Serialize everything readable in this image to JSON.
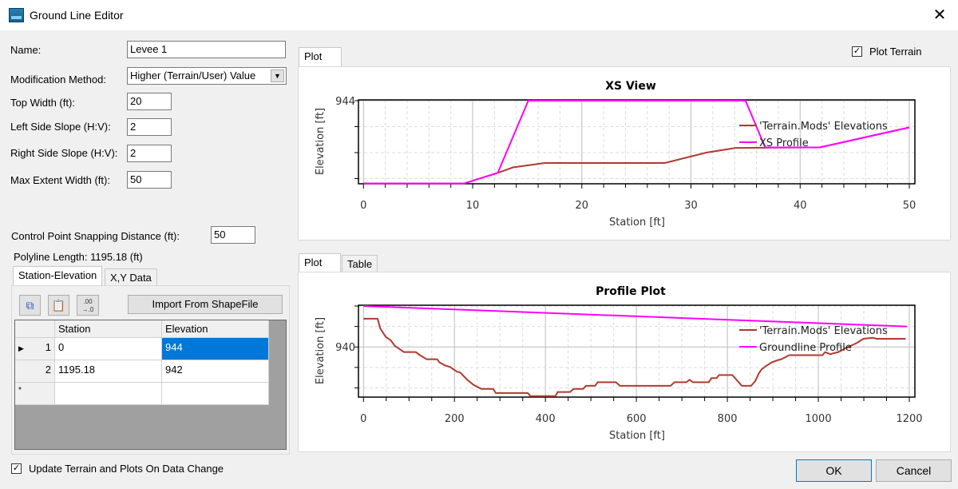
{
  "window": {
    "title": "Ground Line Editor",
    "close_icon": "close-icon"
  },
  "form": {
    "name_label": "Name:",
    "name_value": "Levee 1",
    "method_label": "Modification Method:",
    "method_value": "Higher (Terrain/User) Value",
    "top_width_label": "Top Width (ft):",
    "top_width_value": "20",
    "left_slope_label": "Left Side Slope (H:V):",
    "left_slope_value": "2",
    "right_slope_label": "Right Side Slope (H:V):",
    "right_slope_value": "2",
    "max_extent_label": "Max Extent Width (ft):",
    "max_extent_value": "50",
    "snap_label": "Control Point Snapping Distance (ft):",
    "snap_value": "50",
    "polyline_length": "Polyline Length: 1195.18 (ft)"
  },
  "data_tabs": [
    {
      "label": "Station-Elevation",
      "active": true
    },
    {
      "label": "X,Y Data",
      "active": false
    }
  ],
  "toolbar": {
    "copy_icon": "copy-icon",
    "paste_icon": "paste-icon",
    "decimals_icon": "decimal-places-icon",
    "decimals_text": ".00\n→.0",
    "import_label": "Import From ShapeFile"
  },
  "table": {
    "columns": [
      "Station",
      "Elevation"
    ],
    "rows": [
      {
        "index": "1",
        "station": "0",
        "elevation": "944",
        "current": true
      },
      {
        "index": "2",
        "station": "1195.18",
        "elevation": "942"
      }
    ],
    "new_row_marker": "*"
  },
  "update_checkbox": {
    "label": "Update Terrain and Plots On Data Change",
    "checked": true
  },
  "plot_terrain": {
    "label": "Plot Terrain",
    "checked": true
  },
  "top_tabs": [
    {
      "label": "Plot",
      "active": true
    }
  ],
  "bottom_tabs": [
    {
      "label": "Plot",
      "active": true
    },
    {
      "label": "Table",
      "active": false
    }
  ],
  "buttons": {
    "ok": "OK",
    "cancel": "Cancel"
  },
  "colors": {
    "terrain": "#b03a2e",
    "profile": "#ff00ff",
    "selection": "#0078d7"
  },
  "chart_data": [
    {
      "type": "line",
      "title": "XS View",
      "xlabel": "Station [ft]",
      "ylabel": "Elevation [ft]",
      "xlim": [
        0,
        50
      ],
      "ylim": [
        940.8,
        944
      ],
      "x_ticks": [
        0,
        10,
        20,
        30,
        40,
        50
      ],
      "y_tick_labels": [
        944
      ],
      "grid": true,
      "legend": "top-right",
      "series": [
        {
          "name": "'Terrain.Mods' Elevations",
          "color": "#b03a2e",
          "points": [
            [
              0,
              940.81
            ],
            [
              9.2,
              940.81
            ],
            [
              12.3,
              941.22
            ],
            [
              13.7,
              941.43
            ],
            [
              16.6,
              941.6
            ],
            [
              27.6,
              941.6
            ],
            [
              31.4,
              942.0
            ],
            [
              34.1,
              942.18
            ],
            [
              41.8,
              942.2
            ],
            [
              50,
              942.97
            ]
          ]
        },
        {
          "name": "XS Profile",
          "color": "#ff00ff",
          "points": [
            [
              0,
              940.81
            ],
            [
              9.2,
              940.81
            ],
            [
              12.3,
              941.22
            ],
            [
              15.1,
              944
            ],
            [
              35.0,
              944
            ],
            [
              36.8,
              942.2
            ],
            [
              41.8,
              942.2
            ],
            [
              50,
              942.97
            ]
          ]
        }
      ]
    },
    {
      "type": "line",
      "title": "Profile Plot",
      "xlabel": "Station [ft]",
      "ylabel": "Elevation [ft]",
      "xlim": [
        0,
        1200
      ],
      "ylim": [
        935.1,
        944
      ],
      "x_ticks": [
        0,
        200,
        400,
        600,
        800,
        1000,
        1200
      ],
      "y_tick_labels": [
        940
      ],
      "grid": true,
      "legend": "top-right",
      "series": [
        {
          "name": "'Terrain.Mods' Elevations",
          "color": "#b03a2e",
          "points": [
            [
              0,
              942.76
            ],
            [
              31,
              942.76
            ],
            [
              37,
              941.8
            ],
            [
              49,
              940.98
            ],
            [
              60,
              940.65
            ],
            [
              69,
              940.1
            ],
            [
              89,
              939.5
            ],
            [
              115,
              939.5
            ],
            [
              124,
              939.2
            ],
            [
              139,
              938.8
            ],
            [
              162,
              938.8
            ],
            [
              167,
              938.5
            ],
            [
              179,
              938.2
            ],
            [
              190,
              938.05
            ],
            [
              205,
              937.6
            ],
            [
              213,
              937.5
            ],
            [
              228,
              936.8
            ],
            [
              242,
              936.3
            ],
            [
              259,
              935.9
            ],
            [
              285,
              935.9
            ],
            [
              291,
              935.5
            ],
            [
              361,
              935.5
            ],
            [
              367,
              935.2
            ],
            [
              422,
              935.2
            ],
            [
              427,
              935.6
            ],
            [
              454,
              935.6
            ],
            [
              462,
              935.9
            ],
            [
              483,
              935.9
            ],
            [
              489,
              936.2
            ],
            [
              509,
              936.2
            ],
            [
              515,
              936.55
            ],
            [
              555,
              936.55
            ],
            [
              564,
              936.2
            ],
            [
              675,
              936.2
            ],
            [
              684,
              936.55
            ],
            [
              710,
              936.55
            ],
            [
              717,
              936.8
            ],
            [
              724,
              936.55
            ],
            [
              759,
              936.55
            ],
            [
              765,
              936.95
            ],
            [
              776,
              936.95
            ],
            [
              782,
              937.26
            ],
            [
              811,
              937.26
            ],
            [
              820,
              936.8
            ],
            [
              832,
              936.2
            ],
            [
              852,
              936.2
            ],
            [
              861,
              936.64
            ],
            [
              869,
              937.4
            ],
            [
              875,
              937.8
            ],
            [
              887,
              938.2
            ],
            [
              898,
              938.5
            ],
            [
              910,
              938.7
            ],
            [
              919,
              938.8
            ],
            [
              936,
              939.2
            ],
            [
              1009,
              939.2
            ],
            [
              1015,
              939.5
            ],
            [
              1026,
              939.3
            ],
            [
              1044,
              939.5
            ],
            [
              1061,
              939.9
            ],
            [
              1085,
              940.4
            ],
            [
              1099,
              940.8
            ],
            [
              1120,
              940.9
            ],
            [
              1128,
              940.8
            ],
            [
              1192,
              940.8
            ]
          ]
        },
        {
          "name": "Groundline Profile",
          "color": "#ff00ff",
          "points": [
            [
              0,
              944
            ],
            [
              1195.18,
              942
            ]
          ]
        }
      ]
    }
  ]
}
